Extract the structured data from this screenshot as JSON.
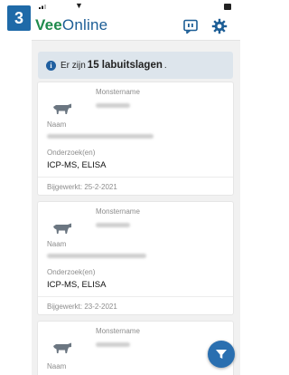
{
  "step_number": "3",
  "app": {
    "title_part1": "Vee",
    "title_part2": "Online"
  },
  "banner": {
    "prefix": "Er zijn",
    "highlight": "15 labuitslagen",
    "suffix": "."
  },
  "cards": [
    {
      "sample_label": "Monstername",
      "name_label": "Naam",
      "tests_label": "Onderzoek(en)",
      "tests_value": "ICP-MS, ELISA",
      "updated": "Bijgewerkt: 25-2-2021"
    },
    {
      "sample_label": "Monstername",
      "name_label": "Naam",
      "tests_label": "Onderzoek(en)",
      "tests_value": "ICP-MS, ELISA",
      "updated": "Bijgewerkt: 23-2-2021"
    },
    {
      "sample_label": "Monstername",
      "name_label": "Naam"
    }
  ],
  "colors": {
    "brand_green": "#1e8a4c",
    "brand_blue": "#1d5e96",
    "accent_blue": "#2a6fb0",
    "badge_blue": "#1f6aa8"
  },
  "icons": [
    "signal-icon",
    "wifi-icon",
    "battery-icon",
    "message-icon",
    "gear-icon",
    "info-icon",
    "cow-icon",
    "filter-icon"
  ]
}
